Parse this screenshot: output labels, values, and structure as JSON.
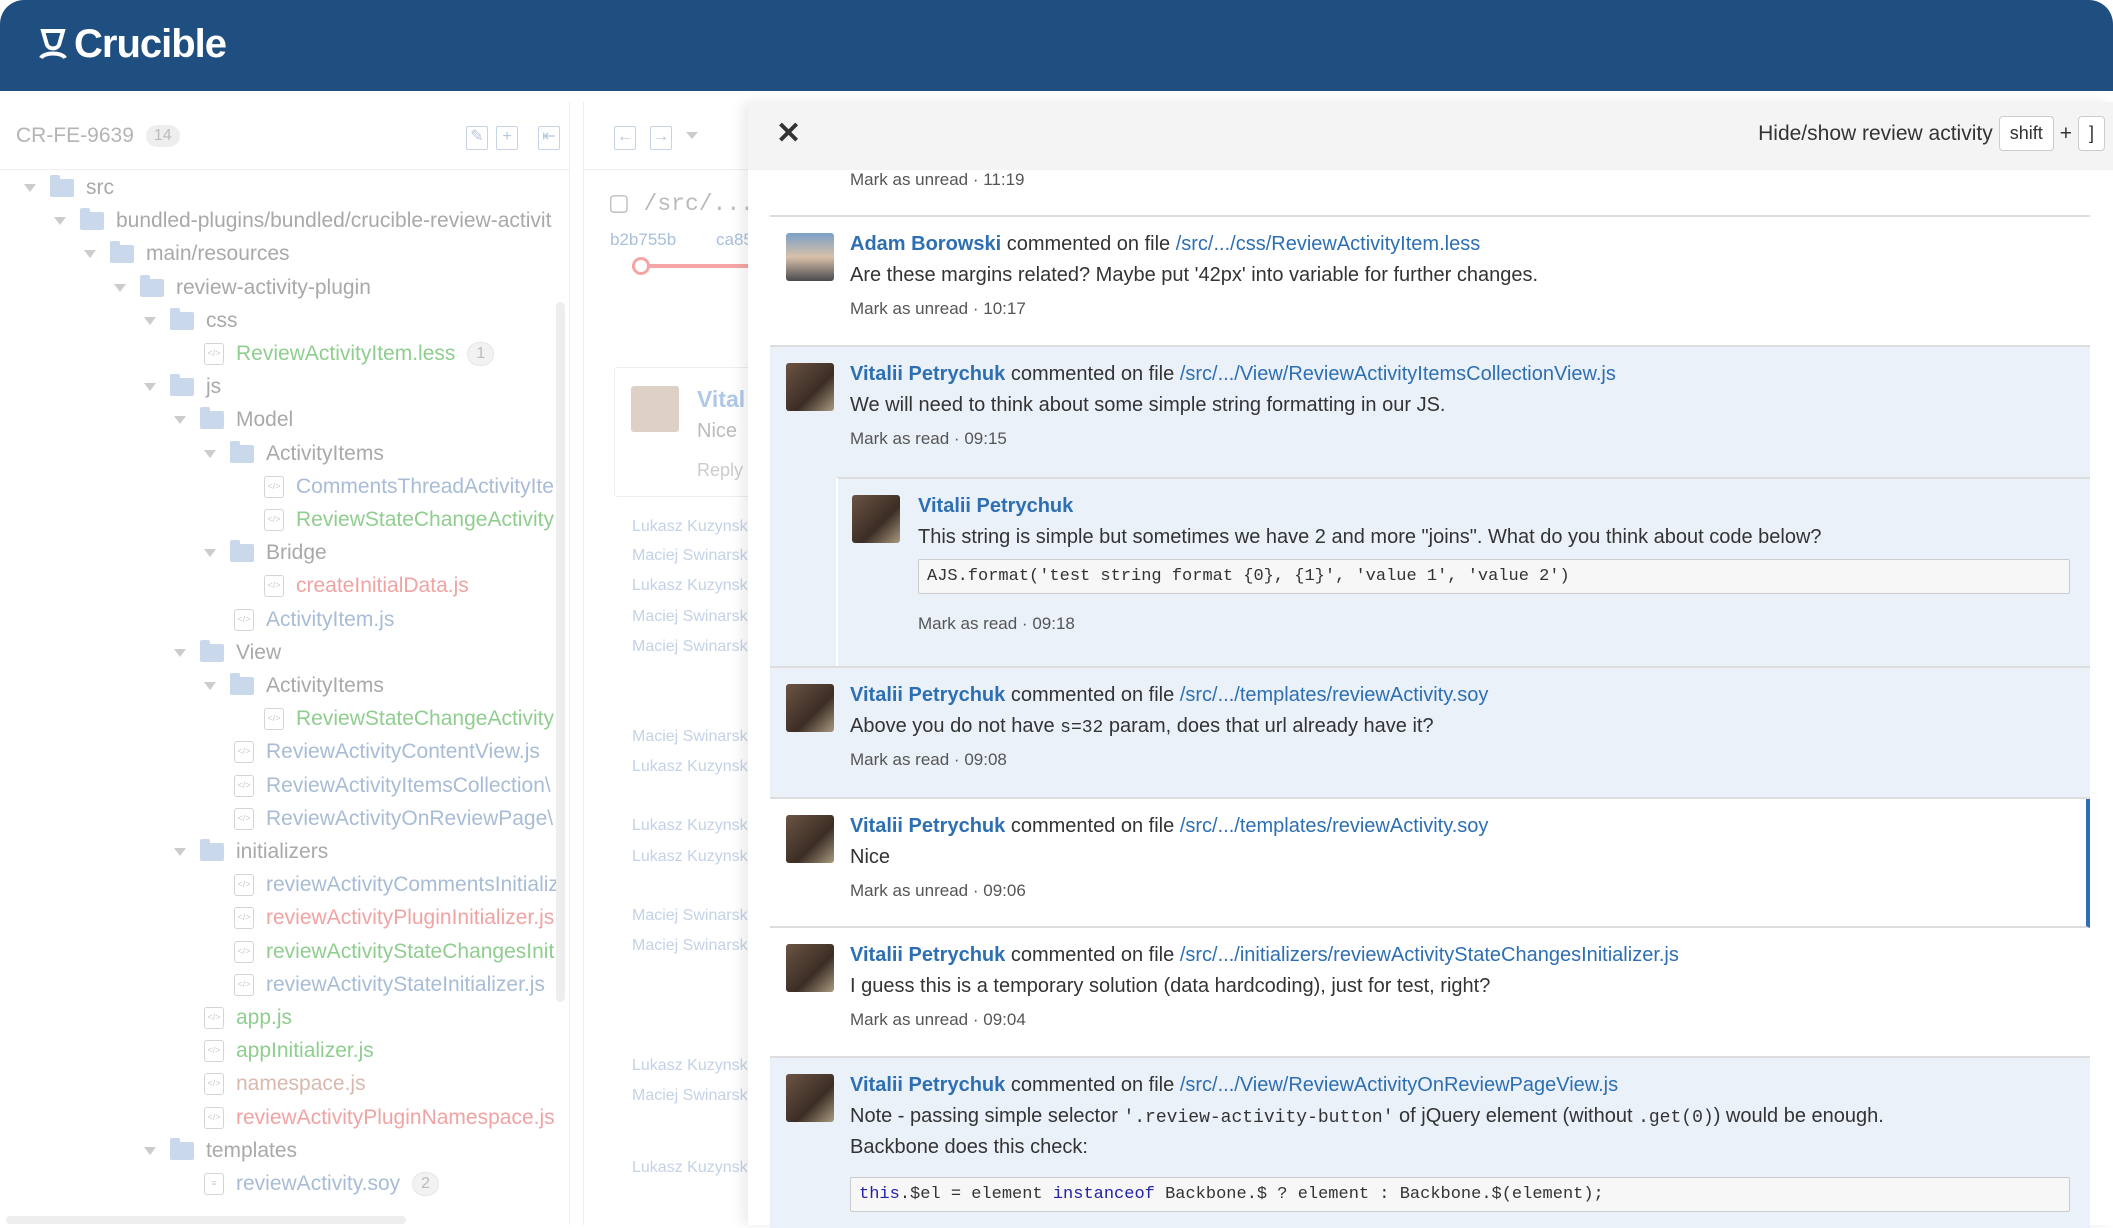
{
  "app": {
    "name": "Crucible",
    "header_color": "#1f4e80"
  },
  "left": {
    "review_id": "CR-FE-9639",
    "count": "14",
    "tree": [
      {
        "level": 0,
        "type": "folder",
        "name": "src",
        "color": "#a9a9a9"
      },
      {
        "level": 1,
        "type": "folder",
        "name": "bundled-plugins/bundled/crucible-review-activit",
        "color": "#a9a9a9"
      },
      {
        "level": 2,
        "type": "folder",
        "name": "main/resources",
        "color": "#a9a9a9"
      },
      {
        "level": 3,
        "type": "folder",
        "name": "review-activity-plugin",
        "color": "#a9a9a9"
      },
      {
        "level": 4,
        "type": "folder",
        "name": "css",
        "color": "#a9a9a9"
      },
      {
        "level": 5,
        "type": "file",
        "name": "ReviewActivityItem.less",
        "color": "#8fce8f",
        "badge": "1"
      },
      {
        "level": 4,
        "type": "folder",
        "name": "js",
        "color": "#a9a9a9"
      },
      {
        "level": 5,
        "type": "folder",
        "name": "Model",
        "color": "#a9a9a9"
      },
      {
        "level": 6,
        "type": "folder",
        "name": "ActivityItems",
        "color": "#a9a9a9"
      },
      {
        "level": 7,
        "type": "file",
        "name": "CommentsThreadActivityIte",
        "color": "#a8bcd6"
      },
      {
        "level": 7,
        "type": "file",
        "name": "ReviewStateChangeActivity",
        "color": "#8fce8f"
      },
      {
        "level": 6,
        "type": "folder",
        "name": "Bridge",
        "color": "#a9a9a9"
      },
      {
        "level": 7,
        "type": "file",
        "name": "createInitialData.js",
        "color": "#f0a3a3"
      },
      {
        "level": 6,
        "type": "file",
        "name": "ActivityItem.js",
        "color": "#a8bcd6"
      },
      {
        "level": 5,
        "type": "folder",
        "name": "View",
        "color": "#a9a9a9"
      },
      {
        "level": 6,
        "type": "folder",
        "name": "ActivityItems",
        "color": "#a9a9a9"
      },
      {
        "level": 7,
        "type": "file",
        "name": "ReviewStateChangeActivity",
        "color": "#8fce8f"
      },
      {
        "level": 6,
        "type": "file",
        "name": "ReviewActivityContentView.js",
        "color": "#a8bcd6"
      },
      {
        "level": 6,
        "type": "file",
        "name": "ReviewActivityItemsCollection\\",
        "color": "#a8bcd6"
      },
      {
        "level": 6,
        "type": "file",
        "name": "ReviewActivityOnReviewPage\\",
        "color": "#a8bcd6"
      },
      {
        "level": 5,
        "type": "folder",
        "name": "initializers",
        "color": "#a9a9a9"
      },
      {
        "level": 6,
        "type": "file",
        "name": "reviewActivityCommentsInitializ",
        "color": "#a8bcd6"
      },
      {
        "level": 6,
        "type": "file",
        "name": "reviewActivityPluginInitializer.js",
        "color": "#f0a3a3"
      },
      {
        "level": 6,
        "type": "file",
        "name": "reviewActivityStateChangesInit",
        "color": "#8fce8f"
      },
      {
        "level": 6,
        "type": "file",
        "name": "reviewActivityStateInitializer.js",
        "color": "#a8bcd6"
      },
      {
        "level": 5,
        "type": "file",
        "name": "app.js",
        "color": "#8fce8f"
      },
      {
        "level": 5,
        "type": "file",
        "name": "appInitializer.js",
        "color": "#8fce8f"
      },
      {
        "level": 5,
        "type": "file",
        "name": "namespace.js",
        "color": "#d9b8ad"
      },
      {
        "level": 5,
        "type": "file",
        "name": "reviewActivityPluginNamespace.js",
        "color": "#f0a3a3"
      },
      {
        "level": 4,
        "type": "folder",
        "name": "templates",
        "color": "#a9a9a9"
      },
      {
        "level": 5,
        "type": "doc",
        "name": "reviewActivity.soy",
        "color": "#a8bcd6",
        "badge": "2"
      }
    ]
  },
  "middle": {
    "path": "/src/.../",
    "revisions": [
      "b2b755b",
      "ca85"
    ],
    "comment_author": "Vital",
    "comment_text": "Nice",
    "reply": "Reply",
    "names": [
      "Lukasz Kuzynsk",
      "Maciej Swinarsk",
      "Lukasz Kuzynsk",
      "Maciej Swinarsk",
      "Maciej Swinarsk",
      "Maciej Swinarsk",
      "Lukasz Kuzynsk",
      "Lukasz Kuzynsk",
      "Lukasz Kuzynsk",
      "Maciej Swinarsk",
      "Maciej Swinarsk",
      "Lukasz Kuzynsk",
      "Maciej Swinarsk",
      "Lukasz Kuzynsk"
    ]
  },
  "panel": {
    "hide_show_label": "Hide/show review activity",
    "key1": "shift",
    "plus": "+",
    "key2": "]",
    "top_mark": "Mark as unread",
    "top_time": "11:19",
    "commented_on": "commented on file",
    "items": [
      {
        "author": "Adam Borowski",
        "file": "/src/.../css/ReviewActivityItem.less",
        "text": "Are these margins related? Maybe put '42px' into variable for further changes.",
        "mark": "Mark as unread",
        "time": "10:17"
      },
      {
        "author": "Vitalii Petrychuk",
        "file": "/src/.../View/ReviewActivityItemsCollectionView.js",
        "text": "We will need to think about some simple string formatting in our JS.",
        "mark": "Mark as read",
        "time": "09:15",
        "reply": {
          "author": "Vitalii Petrychuk",
          "text": "This string is simple but sometimes we have 2 and more \"joins\". What do you think about code below?",
          "code": "AJS.format('test string format {0}, {1}', 'value 1', 'value 2')",
          "mark": "Mark as read",
          "time": "09:18"
        }
      },
      {
        "author": "Vitalii Petrychuk",
        "file": "/src/.../templates/reviewActivity.soy",
        "text_a": "Above you do not have ",
        "text_code": "s=32",
        "text_b": " param, does that url already have it?",
        "mark": "Mark as read",
        "time": "09:08"
      },
      {
        "author": "Vitalii Petrychuk",
        "file": "/src/.../templates/reviewActivity.soy",
        "text": "Nice",
        "mark": "Mark as unread",
        "time": "09:06"
      },
      {
        "author": "Vitalii Petrychuk",
        "file": "/src/.../initializers/reviewActivityStateChangesInitializer.js",
        "text": "I guess this is a temporary solution (data hardcoding), just for test, right?",
        "mark": "Mark as unread",
        "time": "09:04"
      },
      {
        "author": "Vitalii Petrychuk",
        "file": "/src/.../View/ReviewActivityOnReviewPageView.js",
        "t1": "Note - passing simple selector ",
        "c1": "'.review-activity-button'",
        "t2": " of jQuery element (without ",
        "c2": ".get(0)",
        "t3": ") would be enough.",
        "t4": "Backbone does this check:",
        "code_kw1": "this",
        "code_a": ".$el = element ",
        "code_kw2": "instanceof",
        "code_b": " Backbone.$ ? element : Backbone.$(element);"
      }
    ]
  }
}
